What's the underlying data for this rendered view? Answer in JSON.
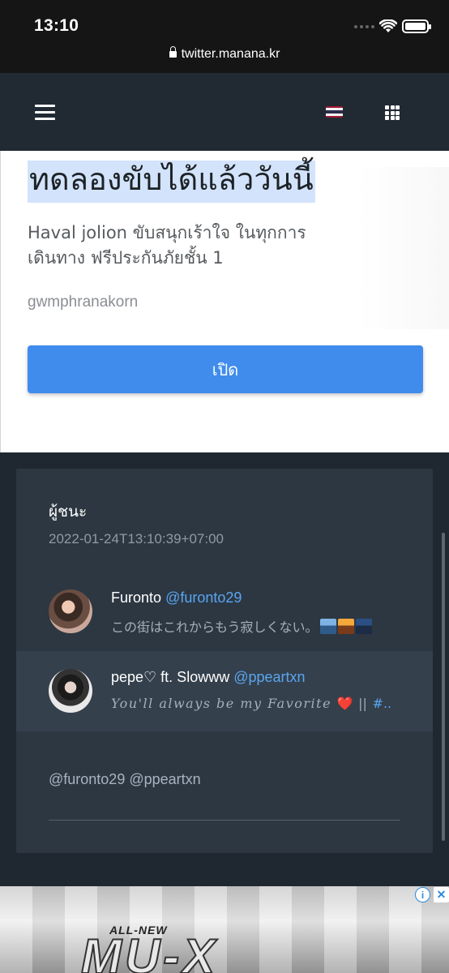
{
  "status_bar": {
    "time": "13:10",
    "url": "twitter.manana.kr"
  },
  "nav": {
    "menu_icon": "hamburger-icon",
    "language_icon": "thai-flag-icon",
    "apps_icon": "grid-icon"
  },
  "ad": {
    "headline": "ทดลองขับได้แล้ววันนี้",
    "description": "Haval jolion ขับสนุกเร้าใจ ในทุกการเดินทาง ฟรีประกันภัยชั้น 1",
    "advertiser": "gwmphranakorn",
    "button_label": "เปิด"
  },
  "card": {
    "title": "ผู้ชนะ",
    "timestamp": "2022-01-24T13:10:39+07:00",
    "tweets": [
      {
        "name": "Furonto",
        "handle": "@furonto29",
        "text": "この街はこれからもう寂しくない。"
      },
      {
        "name": "pepe♡ ft. Slowww",
        "handle": "@ppeartxn",
        "text": "You'll always be my Favorite",
        "heart": "❤️",
        "separator": "||",
        "hashtag": "#..."
      }
    ],
    "mentions": "@furonto29 @ppeartxn"
  },
  "bottom_ad": {
    "tagline": "ALL-NEW",
    "model": "MU-X",
    "info_icon": "i",
    "close_icon": "✕"
  }
}
